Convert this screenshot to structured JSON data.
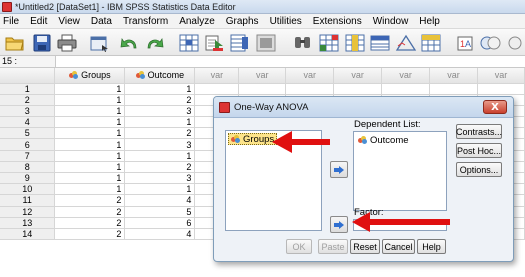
{
  "window": {
    "title": "*Untitled2 [DataSet1] - IBM SPSS Statistics Data Editor"
  },
  "menu": [
    "File",
    "Edit",
    "View",
    "Data",
    "Transform",
    "Analyze",
    "Graphs",
    "Utilities",
    "Extensions",
    "Window",
    "Help"
  ],
  "toolbar_icons": [
    "open-folder-icon",
    "save-icon",
    "print-icon",
    "dialog-recall-icon",
    "undo-icon",
    "redo-icon",
    "go-to-case-icon",
    "go-to-variable-icon",
    "variables-icon",
    "run-descriptives-icon",
    "find-icon",
    "insert-cases-icon",
    "insert-variable-icon",
    "split-file-icon",
    "weight-cases-icon",
    "select-cases-icon",
    "value-labels-icon",
    "use-sets-icon"
  ],
  "cell_indicator": {
    "ref": "15 :"
  },
  "grid": {
    "columns": [
      "Groups",
      "Outcome",
      "var",
      "var",
      "var",
      "var",
      "var",
      "var",
      "var",
      "var"
    ],
    "rows": [
      {
        "n": "1",
        "groups": "1",
        "outcome": "1"
      },
      {
        "n": "2",
        "groups": "1",
        "outcome": "2"
      },
      {
        "n": "3",
        "groups": "1",
        "outcome": "3"
      },
      {
        "n": "4",
        "groups": "1",
        "outcome": "1"
      },
      {
        "n": "5",
        "groups": "1",
        "outcome": "2"
      },
      {
        "n": "6",
        "groups": "1",
        "outcome": "3"
      },
      {
        "n": "7",
        "groups": "1",
        "outcome": "1"
      },
      {
        "n": "8",
        "groups": "1",
        "outcome": "2"
      },
      {
        "n": "9",
        "groups": "1",
        "outcome": "3"
      },
      {
        "n": "10",
        "groups": "1",
        "outcome": "1"
      },
      {
        "n": "11",
        "groups": "2",
        "outcome": "4"
      },
      {
        "n": "12",
        "groups": "2",
        "outcome": "5"
      },
      {
        "n": "13",
        "groups": "2",
        "outcome": "6"
      },
      {
        "n": "14",
        "groups": "2",
        "outcome": "4"
      }
    ]
  },
  "dialog": {
    "title": "One-Way ANOVA",
    "close_label": "X",
    "source_list": [
      "Groups"
    ],
    "dependent_label": "Dependent List:",
    "dependent_list": [
      "Outcome"
    ],
    "factor_label": "Factor:",
    "factor_value": "",
    "side_buttons": {
      "contrasts": "Contrasts...",
      "post_hoc": "Post Hoc...",
      "options": "Options..."
    },
    "bottom_buttons": {
      "ok": "OK",
      "paste": "Paste",
      "reset": "Reset",
      "cancel": "Cancel",
      "help": "Help"
    }
  },
  "colors": {
    "annotation_arrow": "#e01010",
    "selected_item": "#fde48a",
    "move_arrow": "#2f6fd0"
  }
}
